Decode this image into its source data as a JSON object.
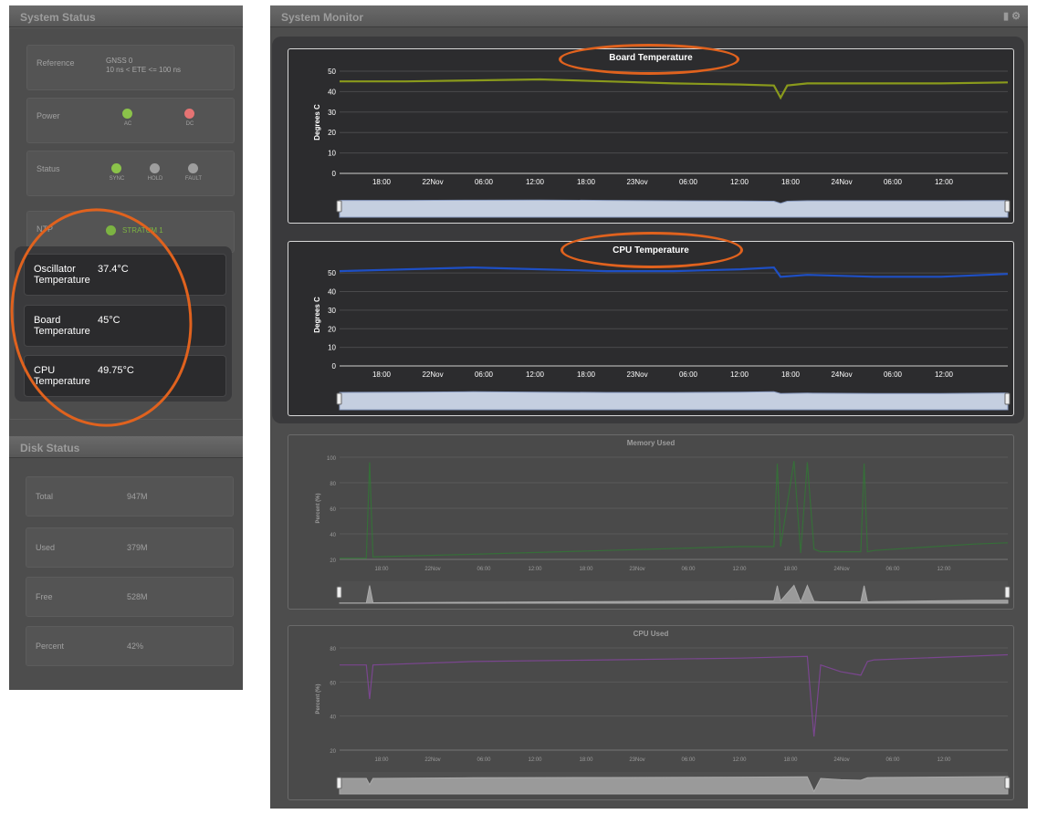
{
  "system_status": {
    "title": "System Status",
    "reference": {
      "label": "Reference",
      "value_line1": "GNSS 0",
      "value_line2": "10 ns < ETE <= 100 ns"
    },
    "power": {
      "label": "Power",
      "leds": [
        {
          "name": "AC",
          "color": "#8bc34a"
        },
        {
          "name": "DC",
          "color": "#e57373"
        }
      ]
    },
    "status": {
      "label": "Status",
      "leds": [
        {
          "name": "SYNC",
          "color": "#8bc34a"
        },
        {
          "name": "HOLD",
          "color": "#9e9e9e"
        },
        {
          "name": "FAULT",
          "color": "#9e9e9e"
        }
      ]
    },
    "ntp": {
      "label": "NTP",
      "value": "STRATUM 1",
      "color": "#7cb342"
    },
    "temperatures": [
      {
        "label": "Oscillator Temperature",
        "value": "37.4°C"
      },
      {
        "label": "Board Temperature",
        "value": "45°C"
      },
      {
        "label": "CPU Temperature",
        "value": "49.75°C"
      }
    ]
  },
  "disk_status": {
    "title": "Disk Status",
    "rows": [
      {
        "label": "Total",
        "value": "947M"
      },
      {
        "label": "Used",
        "value": "379M"
      },
      {
        "label": "Free",
        "value": "528M"
      },
      {
        "label": "Percent",
        "value": "42%"
      }
    ]
  },
  "system_monitor": {
    "title": "System Monitor",
    "icons": [
      "pin-icon",
      "gear-icon"
    ]
  },
  "chart_data": [
    {
      "type": "line",
      "title": "Board Temperature",
      "ylabel": "Degrees C",
      "ylim": [
        0,
        50
      ],
      "yticks": [
        0,
        10,
        20,
        30,
        40,
        50
      ],
      "xticks": [
        "18:00",
        "22Nov",
        "06:00",
        "12:00",
        "18:00",
        "23Nov",
        "06:00",
        "12:00",
        "18:00",
        "24Nov",
        "06:00",
        "12:00"
      ],
      "color": "#8a9a1c",
      "x": [
        0,
        0.1,
        0.2,
        0.3,
        0.4,
        0.5,
        0.6,
        0.65,
        0.66,
        0.67,
        0.7,
        0.8,
        0.9,
        1.0
      ],
      "values": [
        45,
        45,
        45.5,
        46,
        45,
        44,
        43.5,
        43,
        37,
        43,
        44,
        44,
        44,
        44.5
      ]
    },
    {
      "type": "line",
      "title": "CPU Temperature",
      "ylabel": "Degrees C",
      "ylim": [
        0,
        55
      ],
      "yticks": [
        0,
        10,
        20,
        30,
        40,
        50
      ],
      "xticks": [
        "18:00",
        "22Nov",
        "06:00",
        "12:00",
        "18:00",
        "23Nov",
        "06:00",
        "12:00",
        "18:00",
        "24Nov",
        "06:00",
        "12:00"
      ],
      "color": "#1e4fc4",
      "x": [
        0,
        0.1,
        0.2,
        0.3,
        0.4,
        0.5,
        0.6,
        0.65,
        0.66,
        0.7,
        0.8,
        0.9,
        1.0
      ],
      "values": [
        51,
        52,
        53,
        52,
        51,
        51,
        52,
        53,
        48,
        49,
        48,
        48,
        49.5
      ]
    },
    {
      "type": "line",
      "title": "Memory Used",
      "ylabel": "Percent (%)",
      "ylim": [
        20,
        100
      ],
      "yticks": [
        20,
        40,
        60,
        80,
        100
      ],
      "xticks": [
        "18:00",
        "22Nov",
        "06:00",
        "12:00",
        "18:00",
        "23Nov",
        "06:00",
        "12:00",
        "18:00",
        "24Nov",
        "06:00",
        "12:00"
      ],
      "color": "#2e7d32",
      "x": [
        0,
        0.04,
        0.045,
        0.05,
        0.2,
        0.4,
        0.6,
        0.65,
        0.655,
        0.66,
        0.68,
        0.69,
        0.7,
        0.71,
        0.72,
        0.78,
        0.785,
        0.79,
        0.8,
        0.95,
        1.0
      ],
      "values": [
        21,
        21,
        96,
        22,
        24,
        27,
        30,
        30,
        95,
        30,
        97,
        25,
        96,
        28,
        26,
        26,
        95,
        26,
        27,
        32,
        33
      ]
    },
    {
      "type": "line",
      "title": "CPU Used",
      "ylabel": "Percent (%)",
      "ylim": [
        20,
        80
      ],
      "yticks": [
        20,
        40,
        60,
        80
      ],
      "xticks": [
        "18:00",
        "22Nov",
        "06:00",
        "12:00",
        "18:00",
        "23Nov",
        "06:00",
        "12:00",
        "18:00",
        "24Nov",
        "06:00",
        "12:00"
      ],
      "color": "#8e44ad",
      "x": [
        0,
        0.04,
        0.045,
        0.05,
        0.2,
        0.4,
        0.6,
        0.7,
        0.71,
        0.72,
        0.75,
        0.78,
        0.79,
        0.8,
        1.0
      ],
      "values": [
        70,
        70,
        50,
        70,
        72,
        73,
        74,
        75,
        28,
        70,
        66,
        64,
        72,
        73,
        76
      ]
    }
  ]
}
